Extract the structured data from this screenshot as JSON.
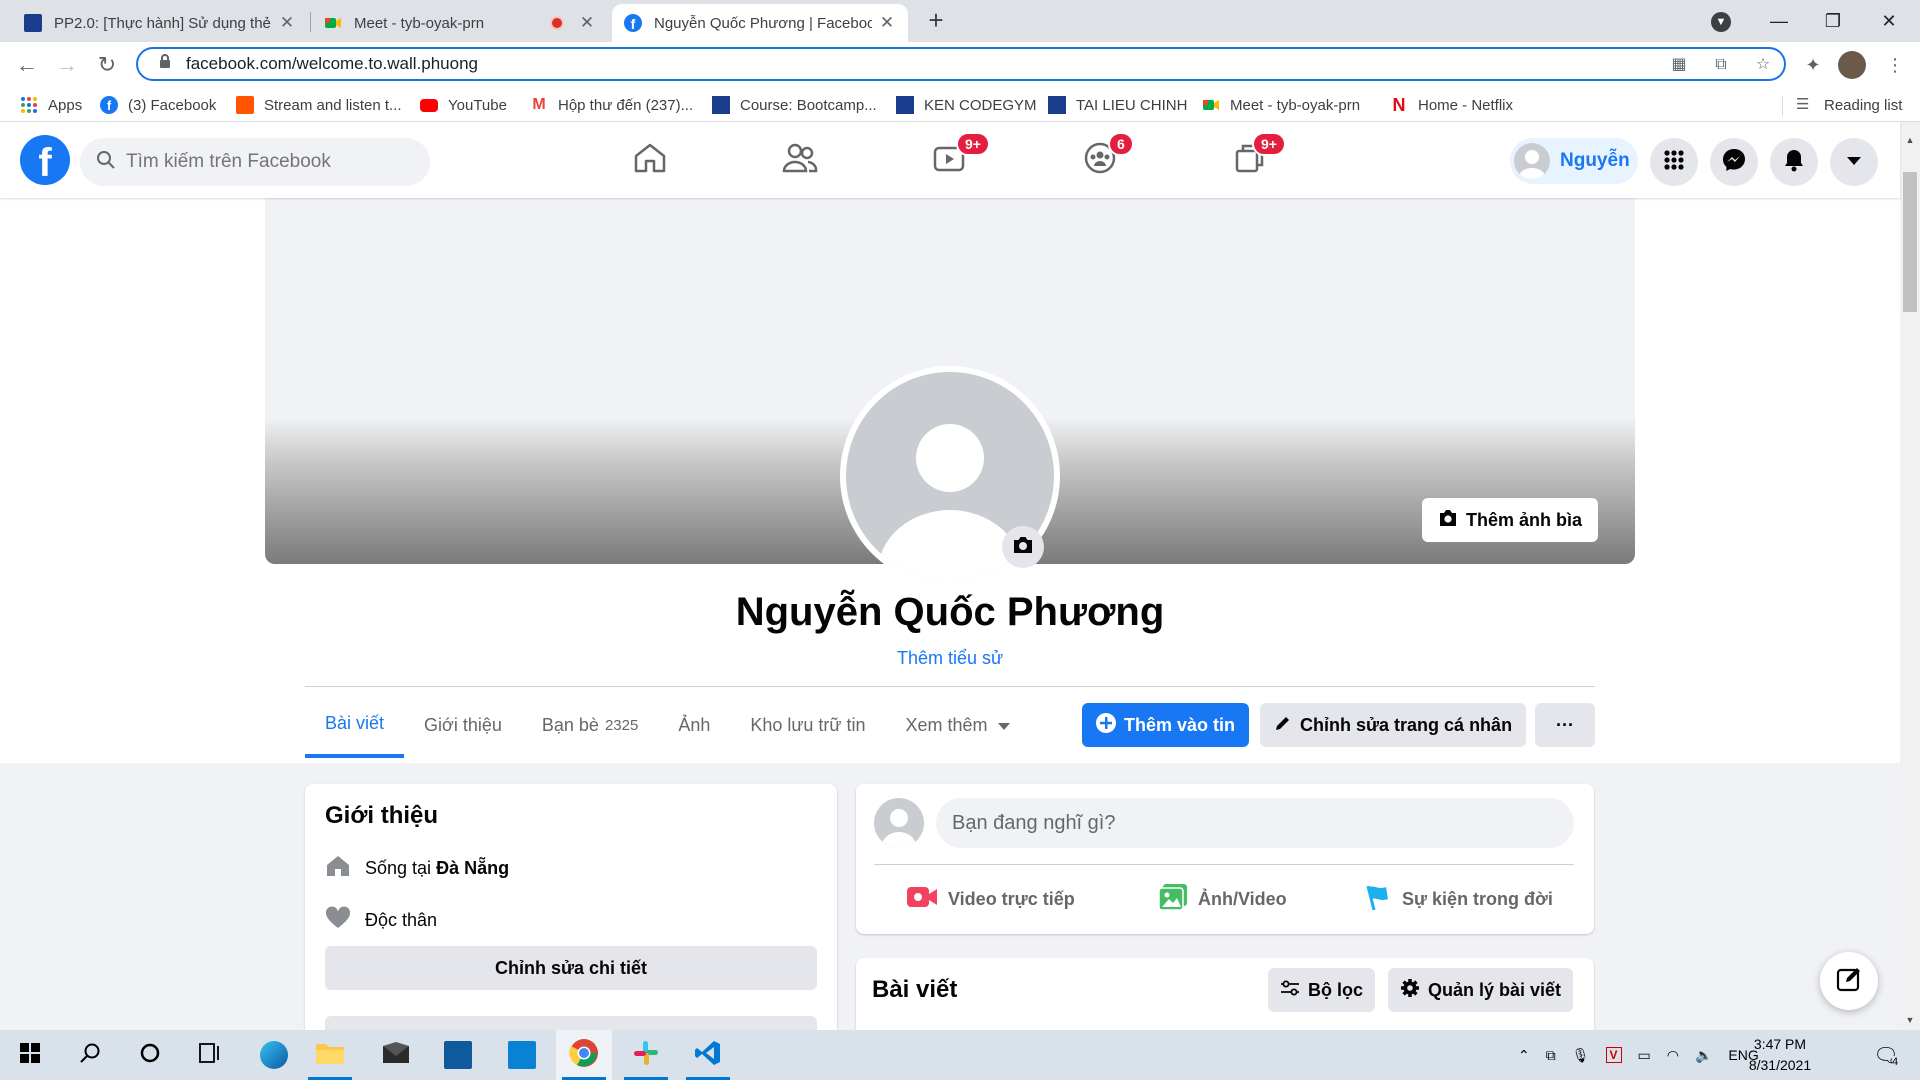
{
  "browser": {
    "tabs": [
      {
        "title": "PP2.0: [Thực hành] Sử dụng thẻ",
        "active": false
      },
      {
        "title": "Meet - tyb-oyak-prn",
        "active": false,
        "recording": true
      },
      {
        "title": "Nguyễn Quốc Phương | Facebook",
        "active": true
      }
    ],
    "url": "facebook.com/welcome.to.wall.phuong",
    "bookmarks": [
      "Apps",
      "(3) Facebook",
      "Stream and listen t...",
      "YouTube",
      "Hộp thư đến (237)...",
      "Course: Bootcamp...",
      "KEN CODEGYM",
      "TAI LIEU CHINH",
      "Meet - tyb-oyak-prn",
      "Home - Netflix"
    ],
    "reading_list": "Reading list"
  },
  "fb": {
    "search_placeholder": "Tìm kiếm trên Facebook",
    "badges": {
      "watch": "9+",
      "groups": "6",
      "gaming": "9+"
    },
    "me_name": "Nguyễn",
    "brand_color": "#1877f2"
  },
  "profile": {
    "name": "Nguyễn Quốc Phương",
    "add_bio": "Thêm tiểu sử",
    "add_cover": "Thêm ảnh bìa",
    "tabs": {
      "posts": "Bài viết",
      "about": "Giới thiệu",
      "friends": "Bạn bè",
      "friends_count": "2325",
      "photos": "Ảnh",
      "archive": "Kho lưu trữ tin",
      "more": "Xem thêm"
    },
    "add_story": "Thêm vào tin",
    "edit_profile": "Chỉnh sửa trang cá nhân",
    "more_dots": "···"
  },
  "intro": {
    "title": "Giới thiệu",
    "lives_prefix": "Sống tại",
    "lives_city": "Đà Nẵng",
    "relationship": "Độc thân",
    "edit_details": "Chỉnh sửa chi tiết"
  },
  "composer": {
    "placeholder": "Bạn đang nghĩ gì?",
    "live": "Video trực tiếp",
    "photo": "Ảnh/Video",
    "life_event": "Sự kiện trong đời"
  },
  "posts": {
    "title": "Bài viết",
    "filter": "Bộ lọc",
    "manage": "Quản lý bài viết"
  },
  "taskbar": {
    "lang": "ENG",
    "time": "3:47 PM",
    "date": "8/31/2021",
    "notifications": "4"
  }
}
